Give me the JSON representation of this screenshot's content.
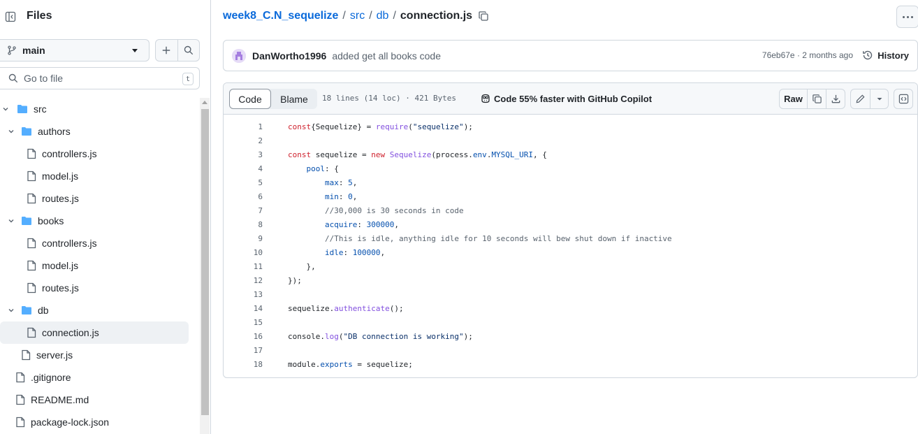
{
  "sidebar": {
    "title": "Files",
    "branch": "main",
    "search_placeholder": "Go to file",
    "search_shortcut": "t",
    "tree": [
      {
        "name": "src",
        "type": "folder",
        "expanded": true
      },
      {
        "name": "authors",
        "type": "folder",
        "expanded": true
      },
      {
        "name": "controllers.js",
        "type": "file"
      },
      {
        "name": "model.js",
        "type": "file"
      },
      {
        "name": "routes.js",
        "type": "file"
      },
      {
        "name": "books",
        "type": "folder",
        "expanded": true
      },
      {
        "name": "controllers.js",
        "type": "file"
      },
      {
        "name": "model.js",
        "type": "file"
      },
      {
        "name": "routes.js",
        "type": "file"
      },
      {
        "name": "db",
        "type": "folder",
        "expanded": true
      },
      {
        "name": "connection.js",
        "type": "file",
        "selected": true
      },
      {
        "name": "server.js",
        "type": "file"
      },
      {
        "name": ".gitignore",
        "type": "file"
      },
      {
        "name": "README.md",
        "type": "file"
      },
      {
        "name": "package-lock.json",
        "type": "file"
      }
    ]
  },
  "breadcrumb": {
    "repo": "week8_C.N_sequelize",
    "sep": "/",
    "segments": [
      "src",
      "db"
    ],
    "current": "connection.js"
  },
  "commit": {
    "author": "DanWortho1996",
    "message": "added get all books code",
    "meta": "76eb67e · 2 months ago",
    "history_label": "History"
  },
  "file": {
    "tab_code": "Code",
    "tab_blame": "Blame",
    "stats": "18 lines (14 loc) · 421 Bytes",
    "copilot": "Code 55% faster with GitHub Copilot",
    "raw_label": "Raw",
    "lines": [
      [
        [
          "kw",
          "const"
        ],
        [
          "t",
          "{Sequelize} = "
        ],
        [
          "fn",
          "require"
        ],
        [
          "t",
          "("
        ],
        [
          "str",
          "\"sequelize\""
        ],
        [
          "t",
          ");"
        ]
      ],
      [],
      [
        [
          "kw",
          "const"
        ],
        [
          "t",
          " sequelize = "
        ],
        [
          "kw",
          "new"
        ],
        [
          "t",
          " "
        ],
        [
          "fn",
          "Sequelize"
        ],
        [
          "t",
          "(process."
        ],
        [
          "prop",
          "env"
        ],
        [
          "t",
          "."
        ],
        [
          "prop",
          "MYSQL_URI"
        ],
        [
          "t",
          ", {"
        ]
      ],
      [
        [
          "t",
          "    "
        ],
        [
          "prop",
          "pool"
        ],
        [
          "t",
          ": {"
        ]
      ],
      [
        [
          "t",
          "        "
        ],
        [
          "prop",
          "max"
        ],
        [
          "t",
          ": "
        ],
        [
          "num",
          "5"
        ],
        [
          "t",
          ","
        ]
      ],
      [
        [
          "t",
          "        "
        ],
        [
          "prop",
          "min"
        ],
        [
          "t",
          ": "
        ],
        [
          "num",
          "0"
        ],
        [
          "t",
          ","
        ]
      ],
      [
        [
          "t",
          "        "
        ],
        [
          "com",
          "//30,000 is 30 seconds in code"
        ]
      ],
      [
        [
          "t",
          "        "
        ],
        [
          "prop",
          "acquire"
        ],
        [
          "t",
          ": "
        ],
        [
          "num",
          "300000"
        ],
        [
          "t",
          ","
        ]
      ],
      [
        [
          "t",
          "        "
        ],
        [
          "com",
          "//This is idle, anything idle for 10 seconds will bew shut down if inactive"
        ]
      ],
      [
        [
          "t",
          "        "
        ],
        [
          "prop",
          "idle"
        ],
        [
          "t",
          ": "
        ],
        [
          "num",
          "100000"
        ],
        [
          "t",
          ","
        ]
      ],
      [
        [
          "t",
          "    },"
        ]
      ],
      [
        [
          "t",
          "});"
        ]
      ],
      [],
      [
        [
          "t",
          "sequelize."
        ],
        [
          "fn",
          "authenticate"
        ],
        [
          "t",
          "();"
        ]
      ],
      [],
      [
        [
          "t",
          "console."
        ],
        [
          "fn",
          "log"
        ],
        [
          "t",
          "("
        ],
        [
          "str",
          "\"DB connection is working\""
        ],
        [
          "t",
          ");"
        ]
      ],
      [],
      [
        [
          "t",
          "module."
        ],
        [
          "prop",
          "exports"
        ],
        [
          "t",
          " = sequelize;"
        ]
      ]
    ]
  },
  "colors": {
    "link": "#0969da",
    "folder": "#54aeff",
    "border": "#d0d7de",
    "muted": "#59636e",
    "keyword": "#cf222e",
    "function": "#8250df",
    "string": "#0a3069",
    "property": "#0550ae"
  },
  "icons": {
    "panel": "sidebar-collapse-icon",
    "branch": "git-branch-icon",
    "add": "plus-icon",
    "search": "search-icon",
    "folder": "folder-icon",
    "file": "file-icon",
    "copy": "copy-icon",
    "history": "history-icon",
    "copilot": "copilot-icon",
    "download": "download-icon",
    "edit": "pencil-icon",
    "symbols": "code-square-icon"
  }
}
